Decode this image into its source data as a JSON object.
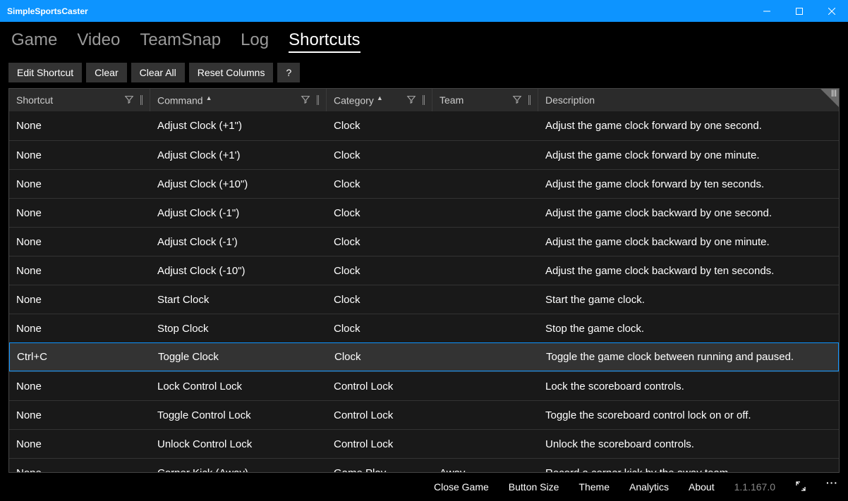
{
  "window": {
    "title": "SimpleSportsCaster"
  },
  "tabs": [
    {
      "label": "Game",
      "active": false
    },
    {
      "label": "Video",
      "active": false
    },
    {
      "label": "TeamSnap",
      "active": false
    },
    {
      "label": "Log",
      "active": false
    },
    {
      "label": "Shortcuts",
      "active": true
    }
  ],
  "toolbar": {
    "edit": "Edit Shortcut",
    "clear": "Clear",
    "clearAll": "Clear All",
    "resetCols": "Reset Columns",
    "help": "?"
  },
  "columns": [
    {
      "label": "Shortcut",
      "sort": "",
      "filter": true,
      "resize": true
    },
    {
      "label": "Command",
      "sort": "▲",
      "filter": true,
      "resize": true
    },
    {
      "label": "Category",
      "sort": "▲",
      "filter": true,
      "resize": true
    },
    {
      "label": "Team",
      "sort": "",
      "filter": true,
      "resize": true
    },
    {
      "label": "Description",
      "sort": "",
      "filter": false,
      "resize": false
    }
  ],
  "rows": [
    {
      "shortcut": "None",
      "command": "Adjust Clock (+1\")",
      "category": "Clock",
      "team": "",
      "desc": "Adjust the game clock forward by one second.",
      "selected": false
    },
    {
      "shortcut": "None",
      "command": "Adjust Clock (+1')",
      "category": "Clock",
      "team": "",
      "desc": "Adjust the game clock forward by one minute.",
      "selected": false
    },
    {
      "shortcut": "None",
      "command": "Adjust Clock (+10\")",
      "category": "Clock",
      "team": "",
      "desc": "Adjust the game clock forward by ten seconds.",
      "selected": false
    },
    {
      "shortcut": "None",
      "command": "Adjust Clock (-1\")",
      "category": "Clock",
      "team": "",
      "desc": "Adjust the game clock backward by one second.",
      "selected": false
    },
    {
      "shortcut": "None",
      "command": "Adjust Clock (-1')",
      "category": "Clock",
      "team": "",
      "desc": "Adjust the game clock backward by one minute.",
      "selected": false
    },
    {
      "shortcut": "None",
      "command": "Adjust Clock (-10\")",
      "category": "Clock",
      "team": "",
      "desc": "Adjust the game clock backward by ten seconds.",
      "selected": false
    },
    {
      "shortcut": "None",
      "command": "Start Clock",
      "category": "Clock",
      "team": "",
      "desc": "Start the game clock.",
      "selected": false
    },
    {
      "shortcut": "None",
      "command": "Stop Clock",
      "category": "Clock",
      "team": "",
      "desc": "Stop the game clock.",
      "selected": false
    },
    {
      "shortcut": "Ctrl+C",
      "command": "Toggle Clock",
      "category": "Clock",
      "team": "",
      "desc": "Toggle the game clock between running and paused.",
      "selected": true
    },
    {
      "shortcut": "None",
      "command": "Lock Control Lock",
      "category": "Control Lock",
      "team": "",
      "desc": "Lock the scoreboard controls.",
      "selected": false
    },
    {
      "shortcut": "None",
      "command": "Toggle Control Lock",
      "category": "Control Lock",
      "team": "",
      "desc": "Toggle the scoreboard control lock on or off.",
      "selected": false
    },
    {
      "shortcut": "None",
      "command": "Unlock Control Lock",
      "category": "Control Lock",
      "team": "",
      "desc": "Unlock the scoreboard controls.",
      "selected": false
    },
    {
      "shortcut": "None",
      "command": "Corner Kick (Away)",
      "category": "Game Play",
      "team": "Away",
      "desc": "Record a corner kick by the away team.",
      "selected": false
    }
  ],
  "bottombar": {
    "closeGame": "Close Game",
    "buttonSize": "Button Size",
    "theme": "Theme",
    "analytics": "Analytics",
    "about": "About",
    "version": "1.1.167.0"
  }
}
